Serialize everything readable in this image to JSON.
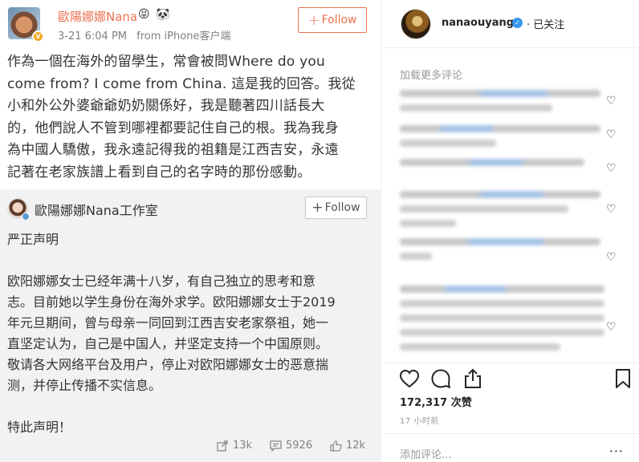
{
  "weibo": {
    "user": "歐陽娜娜Nana",
    "emoji1": "😝",
    "emoji2": "🐼",
    "badge": "V",
    "date": "3-21 6:04 PM",
    "source": "from iPhone客户端",
    "follow_label": "Follow",
    "post_lines": [
      "作為一個在海外的留學生，常會被問Where do you",
      "come from? I come from China. 這是我的回答。我從",
      "小和外公外婆爺爺奶奶關係好，我是聽著四川話長大",
      "的，他們說人不管到哪裡都要記住自己的根。我為我身",
      "為中國人驕傲，我永遠記得我的祖籍是江西吉安，永遠",
      "記著在老家族譜上看到自己的名字時的那份感動。"
    ],
    "repost": {
      "user": "歐陽娜娜Nana工作室",
      "follow_label": "Follow",
      "title": "严正声明",
      "body_lines": [
        "欧阳娜娜女士已经年满十八岁，有自己独立的思考和意",
        "志。目前她以学生身份在海外求学。欧阳娜娜女士于2019",
        "年元旦期间，曾与母亲一同回到江西吉安老家祭祖，她一",
        "直坚定认为，自己是中国人，并坚定支持一个中国原则。",
        "敬请各大网络平台及用户，停止对欧阳娜娜女士的恶意揣",
        "测，并停止传播不实信息。"
      ],
      "closing": "特此声明！"
    },
    "stats": {
      "shares": "13k",
      "comments": "5926",
      "likes": "12k"
    }
  },
  "instagram": {
    "username": "nanaouyang",
    "follow_status": "· 已关注",
    "load_more": "加载更多评论",
    "like_count": "172,317 次赞",
    "time_ago": "17 小时前",
    "add_comment_placeholder": "添加评论...",
    "more": "···"
  }
}
